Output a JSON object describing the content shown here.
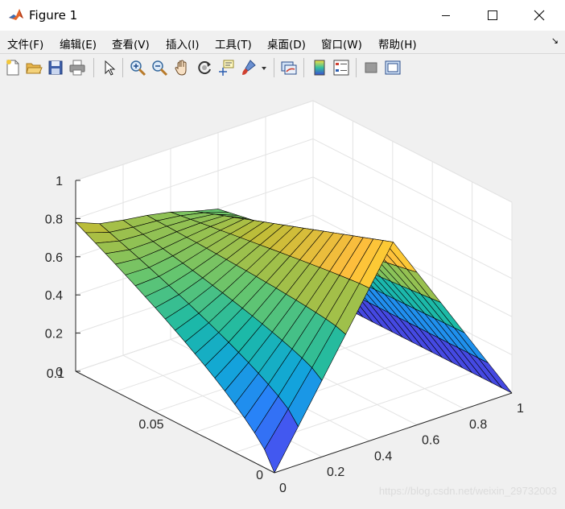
{
  "window": {
    "title": "Figure 1",
    "minimize_icon": "minimize-icon",
    "maximize_icon": "maximize-icon",
    "close_icon": "close-icon"
  },
  "menu": {
    "items": [
      "文件(F)",
      "编辑(E)",
      "查看(V)",
      "插入(I)",
      "工具(T)",
      "桌面(D)",
      "窗口(W)",
      "帮助(H)"
    ],
    "overflow_icon": "dock-arrow-icon"
  },
  "toolbar": {
    "icons": [
      "new-figure-icon",
      "open-file-icon",
      "save-icon",
      "print-icon",
      "edit-plot-pointer-icon",
      "zoom-in-icon",
      "zoom-out-icon",
      "pan-hand-icon",
      "rotate-3d-icon",
      "data-cursor-icon",
      "brush-icon",
      "brush-dropdown-icon",
      "link-plot-icon",
      "insert-colorbar-icon",
      "insert-legend-icon",
      "hide-plot-tools-icon",
      "show-plot-tools-icon"
    ]
  },
  "watermark": "https://blog.csdn.net/weixin_29732003",
  "chart_data": {
    "type": "surface",
    "title": "",
    "xlabel": "",
    "ylabel": "",
    "zlabel": "",
    "colormap": "parula",
    "grid": true,
    "x_ticks": [
      "0",
      "0.2",
      "0.4",
      "0.6",
      "0.8",
      "1"
    ],
    "y_ticks": [
      "0",
      "0.05",
      "0.1"
    ],
    "z_ticks": [
      "0",
      "0.2",
      "0.4",
      "0.6",
      "0.8",
      "1"
    ],
    "xlim": [
      0,
      1
    ],
    "ylim": [
      0,
      0.1
    ],
    "zlim": [
      0,
      1
    ],
    "x": [
      0,
      0.1,
      0.2,
      0.3,
      0.4,
      0.5,
      0.6,
      0.7,
      0.8,
      0.9,
      1.0
    ],
    "y": [
      0,
      0.005,
      0.01,
      0.015,
      0.02,
      0.025,
      0.03,
      0.035,
      0.04,
      0.045,
      0.05,
      0.055,
      0.06,
      0.065,
      0.07,
      0.075,
      0.08,
      0.085,
      0.09,
      0.095,
      0.1
    ],
    "surface_description": "initial profile at t=0 is a tent rising linearly from 0 at x=0 to 1 at x=0.5 and falling to 0 at x=1; it smooths and decays to about 0.6 peak at t=0.1; boundary at x=0 rises from 0 toward 0.8"
  }
}
